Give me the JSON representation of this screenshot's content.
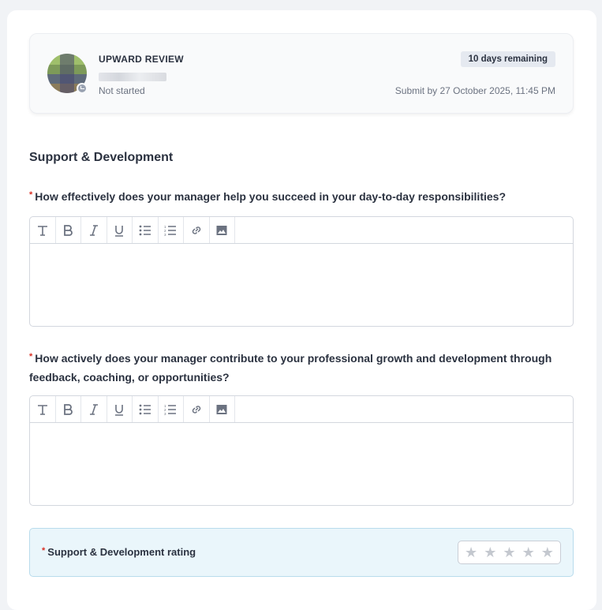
{
  "review": {
    "type_label": "UPWARD REVIEW",
    "status": "Not started",
    "days_remaining": "10 days remaining",
    "deadline": "Submit by 27 October 2025, 11:45 PM"
  },
  "section": {
    "title": "Support & Development"
  },
  "questions": [
    {
      "required_mark": "*",
      "text": "How effectively does your manager help you succeed in your day-to-day responsibilities?",
      "answer": ""
    },
    {
      "required_mark": "*",
      "text": "How actively does your manager contribute to your professional growth and development through feedback, coaching, or opportunities?",
      "answer": ""
    }
  ],
  "toolbar_icons": [
    "text-style-icon",
    "bold-icon",
    "italic-icon",
    "underline-icon",
    "bulleted-list-icon",
    "numbered-list-icon",
    "link-icon",
    "image-icon"
  ],
  "rating": {
    "required_mark": "*",
    "label": "Support & Development rating",
    "value": 0,
    "max": 5
  },
  "colors": {
    "required": "#d93025",
    "rating_bg": "#eaf6fb",
    "star_empty": "#c4c8cf"
  }
}
